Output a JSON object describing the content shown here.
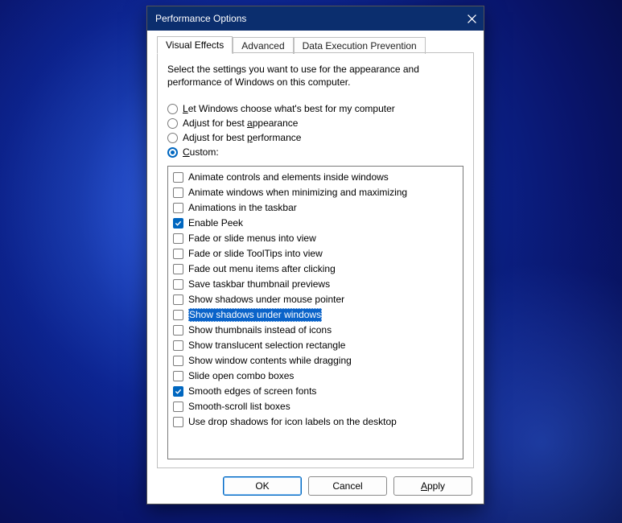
{
  "window": {
    "title": "Performance Options"
  },
  "tabs": [
    {
      "label": "Visual Effects",
      "active": true
    },
    {
      "label": "Advanced",
      "active": false
    },
    {
      "label": "Data Execution Prevention",
      "active": false
    }
  ],
  "intro": "Select the settings you want to use for the appearance and performance of Windows on this computer.",
  "radios": [
    {
      "id": "let-windows",
      "label_html": "<u>L</u>et Windows choose what's best for my computer",
      "label_text": "Let Windows choose what's best for my computer",
      "selected": false
    },
    {
      "id": "best-appearance",
      "label_html": "Adjust for best <u>a</u>ppearance",
      "label_text": "Adjust for best appearance",
      "selected": false
    },
    {
      "id": "best-performance",
      "label_html": "Adjust for best <u>p</u>erformance",
      "label_text": "Adjust for best performance",
      "selected": false
    },
    {
      "id": "custom",
      "label_html": "<u>C</u>ustom:",
      "label_text": "Custom:",
      "selected": true
    }
  ],
  "options": [
    {
      "label": "Animate controls and elements inside windows",
      "checked": false,
      "selected": false
    },
    {
      "label": "Animate windows when minimizing and maximizing",
      "checked": false,
      "selected": false
    },
    {
      "label": "Animations in the taskbar",
      "checked": false,
      "selected": false
    },
    {
      "label": "Enable Peek",
      "checked": true,
      "selected": false
    },
    {
      "label": "Fade or slide menus into view",
      "checked": false,
      "selected": false
    },
    {
      "label": "Fade or slide ToolTips into view",
      "checked": false,
      "selected": false
    },
    {
      "label": "Fade out menu items after clicking",
      "checked": false,
      "selected": false
    },
    {
      "label": "Save taskbar thumbnail previews",
      "checked": false,
      "selected": false
    },
    {
      "label": "Show shadows under mouse pointer",
      "checked": false,
      "selected": false
    },
    {
      "label": "Show shadows under windows",
      "checked": false,
      "selected": true
    },
    {
      "label": "Show thumbnails instead of icons",
      "checked": false,
      "selected": false
    },
    {
      "label": "Show translucent selection rectangle",
      "checked": false,
      "selected": false
    },
    {
      "label": "Show window contents while dragging",
      "checked": false,
      "selected": false
    },
    {
      "label": "Slide open combo boxes",
      "checked": false,
      "selected": false
    },
    {
      "label": "Smooth edges of screen fonts",
      "checked": true,
      "selected": false
    },
    {
      "label": "Smooth-scroll list boxes",
      "checked": false,
      "selected": false
    },
    {
      "label": "Use drop shadows for icon labels on the desktop",
      "checked": false,
      "selected": false
    }
  ],
  "buttons": {
    "ok": "OK",
    "cancel": "Cancel",
    "apply_html": "<u>A</u>pply",
    "apply_text": "Apply"
  }
}
